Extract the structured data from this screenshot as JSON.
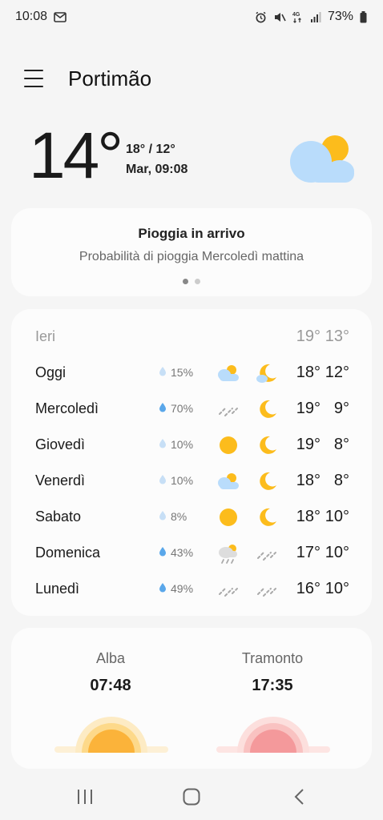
{
  "status_bar": {
    "time": "10:08",
    "battery": "73%",
    "network": "4G"
  },
  "header": {
    "city": "Portimão"
  },
  "current": {
    "temperature": "14°",
    "hi_lo": "18° / 12°",
    "datetime": "Mar, 09:08",
    "icon": "partly-cloudy-icon"
  },
  "alert": {
    "title": "Pioggia in arrivo",
    "subtitle": "Probabilità di pioggia Mercoledì mattina",
    "page_count": 2,
    "active_page": 1
  },
  "forecast": {
    "yesterday": {
      "day": "Ieri",
      "high": "19°",
      "low": "13°"
    },
    "days": [
      {
        "day": "Oggi",
        "precip": "15%",
        "icon_day": "partly-cloudy-icon",
        "icon_night": "cloudy-moon-icon",
        "high": "18°",
        "low": "12°"
      },
      {
        "day": "Mercoledì",
        "precip": "70%",
        "icon_day": "rain-icon",
        "icon_night": "moon-icon",
        "high": "19°",
        "low": "9°"
      },
      {
        "day": "Giovedì",
        "precip": "10%",
        "icon_day": "sun-icon",
        "icon_night": "moon-icon",
        "high": "19°",
        "low": "8°"
      },
      {
        "day": "Venerdì",
        "precip": "10%",
        "icon_day": "partly-cloudy-icon",
        "icon_night": "moon-icon",
        "high": "18°",
        "low": "8°"
      },
      {
        "day": "Sabato",
        "precip": "8%",
        "icon_day": "sun-icon",
        "icon_night": "moon-icon",
        "high": "18°",
        "low": "10°"
      },
      {
        "day": "Domenica",
        "precip": "43%",
        "icon_day": "sun-shower-icon",
        "icon_night": "rain-icon",
        "high": "17°",
        "low": "10°"
      },
      {
        "day": "Lunedì",
        "precip": "49%",
        "icon_day": "rain-icon",
        "icon_night": "rain-icon",
        "high": "16°",
        "low": "10°"
      }
    ]
  },
  "sun": {
    "sunrise_label": "Alba",
    "sunrise_time": "07:48",
    "sunset_label": "Tramonto",
    "sunset_time": "17:35"
  },
  "colors": {
    "sun": "#fcbc1c",
    "cloud": "#b9dcfb",
    "sunrise": "#fbb33a",
    "sunset": "#f4999b",
    "background": "#f5f5f5"
  }
}
